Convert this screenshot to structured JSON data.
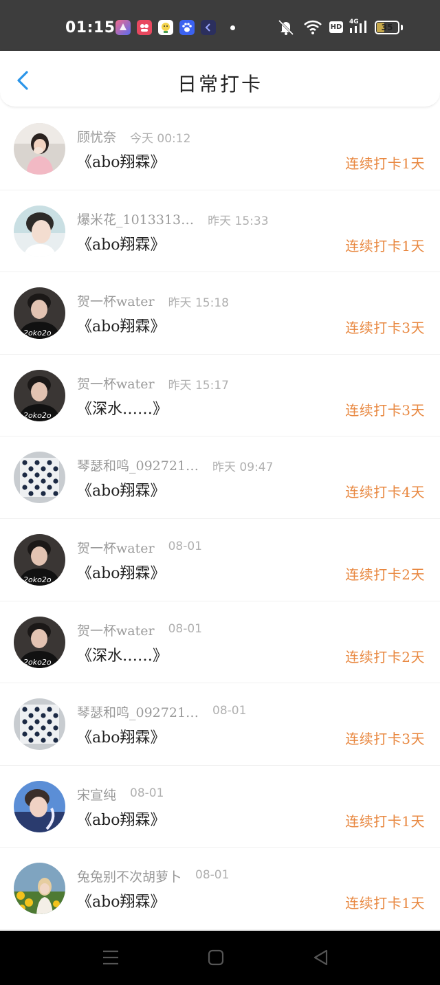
{
  "status_bar": {
    "time": "01:15",
    "apps": [
      {
        "icon": "app-icon-blue-purple",
        "glyph": "",
        "color": "#5b6cf0"
      },
      {
        "icon": "app-icon-red",
        "glyph": "",
        "color": "#e8485f"
      },
      {
        "icon": "app-icon-yellow",
        "glyph": "",
        "color": "#f5d44a"
      },
      {
        "icon": "baidu-paw-icon",
        "glyph": "",
        "color": "#3b62f0"
      },
      {
        "icon": "app-icon-navy-back",
        "glyph": "",
        "color": "#2b2f5e"
      }
    ],
    "hd_label": "HD",
    "network_label": "4G",
    "battery_level": "35",
    "battery_fraction": 0.35
  },
  "header": {
    "title": "日常打卡"
  },
  "accent_color": "#e8873f",
  "checkins": [
    {
      "name": "顾忧奈",
      "time": "今天 00:12",
      "book": "《abo翔霖》",
      "streak": "连续打卡1天",
      "avatar": "avatar-girl-pink"
    },
    {
      "name": "爆米花_1013313…",
      "time": "昨天 15:33",
      "book": "《abo翔霖》",
      "streak": "连续打卡1天",
      "avatar": "avatar-boy-white"
    },
    {
      "name": "贺一杯water",
      "time": "昨天 15:18",
      "book": "《abo翔霖》",
      "streak": "连续打卡3天",
      "avatar": "avatar-boy-black"
    },
    {
      "name": "贺一杯water",
      "time": "昨天 15:17",
      "book": "《深水……》",
      "streak": "连续打卡3天",
      "avatar": "avatar-boy-black"
    },
    {
      "name": "琴瑟和鸣_092721…",
      "time": "昨天 09:47",
      "book": "《abo翔霖》",
      "streak": "连续打卡4天",
      "avatar": "avatar-go-board"
    },
    {
      "name": "贺一杯water",
      "time": "08-01",
      "book": "《abo翔霖》",
      "streak": "连续打卡2天",
      "avatar": "avatar-boy-black"
    },
    {
      "name": "贺一杯water",
      "time": "08-01",
      "book": "《深水……》",
      "streak": "连续打卡2天",
      "avatar": "avatar-boy-black"
    },
    {
      "name": "琴瑟和鸣_092721…",
      "time": "08-01",
      "book": "《abo翔霖》",
      "streak": "连续打卡3天",
      "avatar": "avatar-go-board"
    },
    {
      "name": "宋宣纯",
      "time": "08-01",
      "book": "《abo翔霖》",
      "streak": "连续打卡1天",
      "avatar": "avatar-boy-blue"
    },
    {
      "name": "兔兔别不次胡萝卜",
      "time": "08-01",
      "book": "《abo翔霖》",
      "streak": "连续打卡1天",
      "avatar": "avatar-sunflower-girl"
    }
  ],
  "nav_bar": {
    "buttons": [
      "menu-icon",
      "home-icon",
      "back-triangle-icon"
    ]
  }
}
